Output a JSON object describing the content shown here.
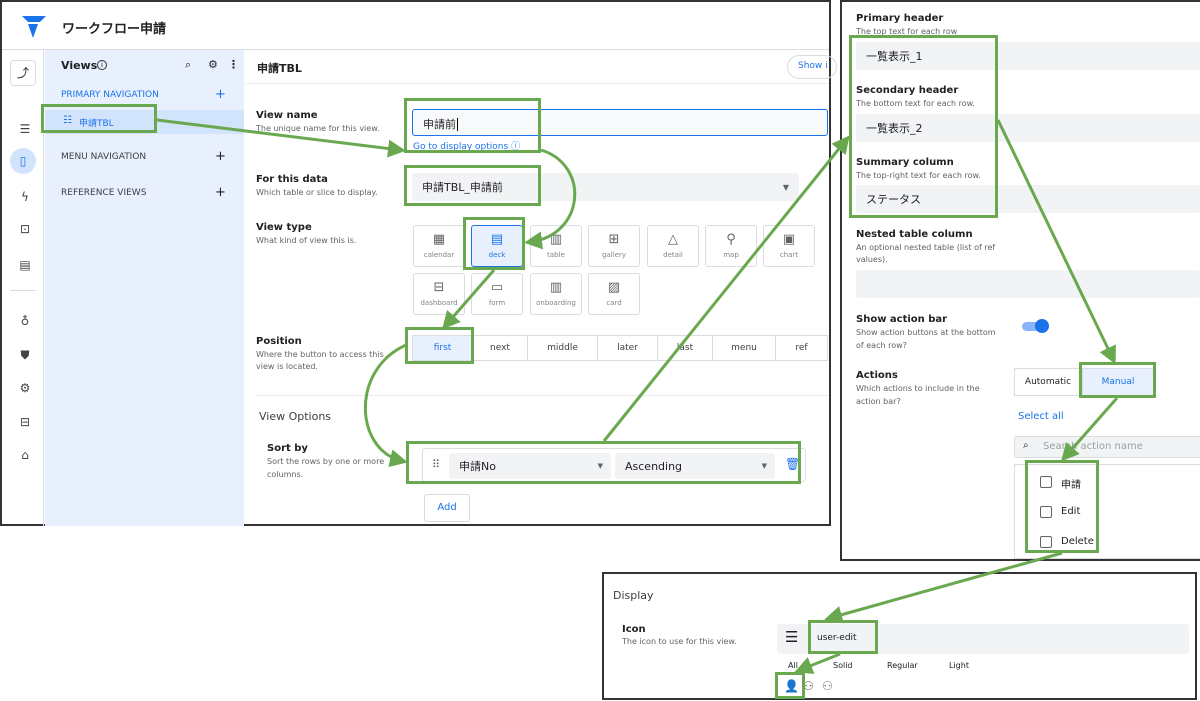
{
  "app": {
    "title": "ワークフロー申請"
  },
  "sidebar": {
    "title": "Views",
    "primary_nav_label": "PRIMARY NAVIGATION",
    "selected_item": "申請TBL",
    "menu_nav_label": "MENU NAVIGATION",
    "reference_views_label": "REFERENCE VIEWS",
    "add_symbol": "+"
  },
  "main": {
    "header_title": "申請TBL",
    "show_button": "Show i",
    "view_name": {
      "label": "View name",
      "desc": "The unique name for this view.",
      "value": "申請前",
      "link": "Go to display options"
    },
    "for_this_data": {
      "label": "For this data",
      "desc": "Which table or slice to display.",
      "value": "申請TBL_申請前"
    },
    "view_type": {
      "label": "View type",
      "desc": "What kind of view this is.",
      "options": [
        "calendar",
        "deck",
        "table",
        "gallery",
        "detail",
        "map",
        "chart",
        "dashboard",
        "form",
        "onboarding",
        "card"
      ],
      "selected": "deck"
    },
    "position": {
      "label": "Position",
      "desc_line1": "Where the button to access this",
      "desc_line2": "view is located.",
      "options": [
        "first",
        "next",
        "middle",
        "later",
        "last",
        "menu",
        "ref"
      ],
      "selected": "first"
    },
    "view_options_title": "View Options",
    "sort_by": {
      "label": "Sort by",
      "desc_line1": "Sort the rows by one or more",
      "desc_line2": "columns.",
      "column": "申請No",
      "order": "Ascending"
    },
    "add_button": "Add"
  },
  "right_panel": {
    "primary_header": {
      "label": "Primary header",
      "desc": "The top text for each row",
      "value": "一覧表示_1"
    },
    "secondary_header": {
      "label": "Secondary header",
      "desc": "The bottom text for each row.",
      "value": "一覧表示_2"
    },
    "summary_column": {
      "label": "Summary column",
      "desc": "The top-right text for each row.",
      "value": "ステータス"
    },
    "nested_table": {
      "label": "Nested table column",
      "desc_line1": "An optional nested table (list of ref",
      "desc_line2": "values)."
    },
    "show_action_bar": {
      "label": "Show action bar",
      "desc_line1": "Show action buttons at the bottom",
      "desc_line2": "of each row?",
      "on": true
    },
    "actions": {
      "label": "Actions",
      "desc_line1": "Which actions to include in the",
      "desc_line2": "action bar?",
      "automatic": "Automatic",
      "manual": "Manual",
      "select_all": "Select all",
      "search_placeholder": "Search action name",
      "items": [
        "申請",
        "Edit",
        "Delete"
      ]
    }
  },
  "display_panel": {
    "title": "Display",
    "icon": {
      "label": "Icon",
      "desc": "The icon to use for this view.",
      "value": "user-edit"
    },
    "tabs": [
      "All",
      "Solid",
      "Regular",
      "Light"
    ]
  },
  "colors": {
    "accent": "#1a73e8",
    "highlight": "#6aa84f",
    "sidebar_bg": "#e8f0fe",
    "selected_bg": "#d2e3fc"
  }
}
